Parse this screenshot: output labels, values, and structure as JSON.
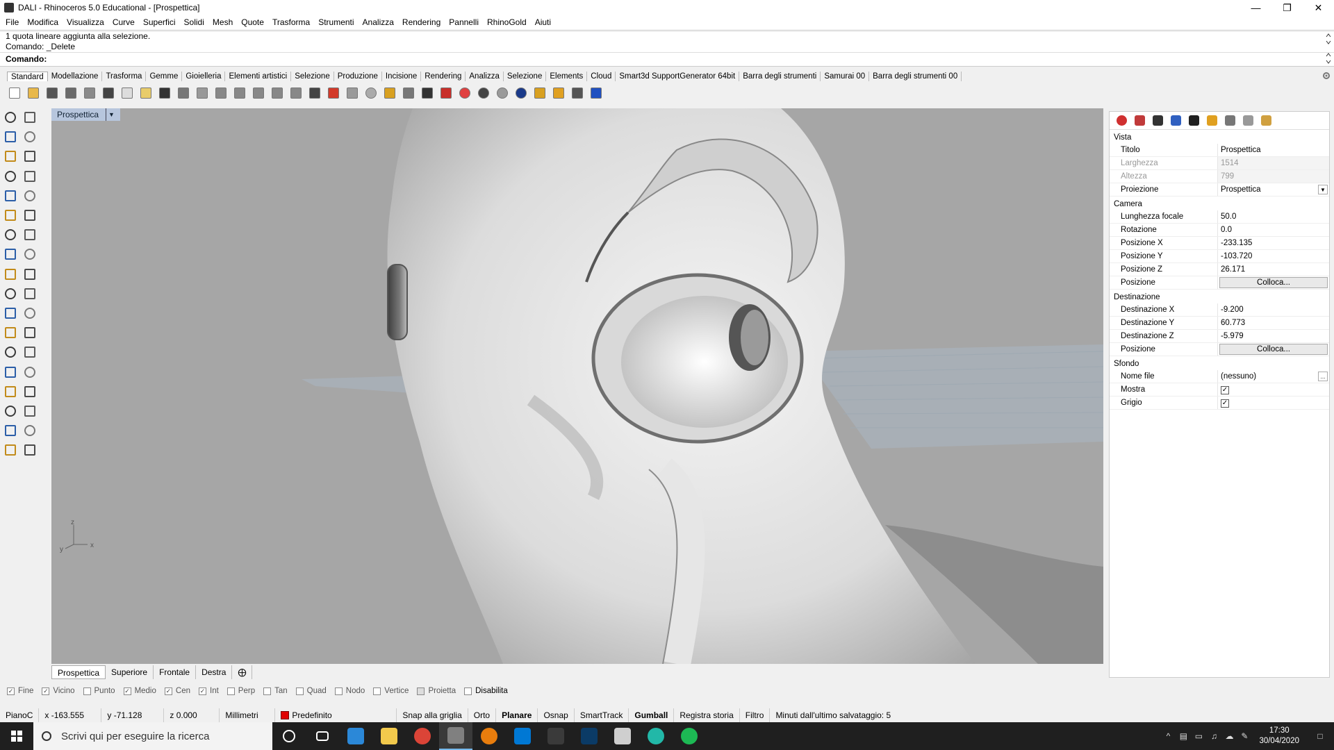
{
  "window": {
    "title": "DALI - Rhinoceros 5.0 Educational - [Prospettica]"
  },
  "menu": [
    "File",
    "Modifica",
    "Visualizza",
    "Curve",
    "Superfici",
    "Solidi",
    "Mesh",
    "Quote",
    "Trasforma",
    "Strumenti",
    "Analizza",
    "Rendering",
    "Pannelli",
    "RhinoGold",
    "Aiuti"
  ],
  "command": {
    "history": [
      "1 quota lineare aggiunta alla selezione.",
      "Comando: _Delete"
    ],
    "prompt": "Comando:"
  },
  "toolbar_tabs": [
    "Standard",
    "Modellazione",
    "Trasforma",
    "Gemme",
    "Gioielleria",
    "Elementi artistici",
    "Selezione",
    "Produzione",
    "Incisione",
    "Rendering",
    "Analizza",
    "Selezione",
    "Elements",
    "Cloud",
    "Smart3d SupportGenerator 64bit",
    "Barra degli strumenti",
    "Samurai 00",
    "Barra degli strumenti 00"
  ],
  "toolbar_icons": [
    {
      "name": "new-file-icon",
      "color": "#ffffff"
    },
    {
      "name": "open-folder-icon",
      "color": "#e8b84a"
    },
    {
      "name": "save-icon",
      "color": "#555555"
    },
    {
      "name": "print-icon",
      "color": "#6a6a6a"
    },
    {
      "name": "import-icon",
      "color": "#8a8a8a"
    },
    {
      "name": "cut-icon",
      "color": "#444444"
    },
    {
      "name": "copy-icon",
      "color": "#dddddd"
    },
    {
      "name": "paste-icon",
      "color": "#e8cc6a"
    },
    {
      "name": "undo-icon",
      "color": "#333333"
    },
    {
      "name": "pan-hand-icon",
      "color": "#777777"
    },
    {
      "name": "rotate-view-icon",
      "color": "#999999"
    },
    {
      "name": "zoom-icon",
      "color": "#888888"
    },
    {
      "name": "zoom-window-icon",
      "color": "#888888"
    },
    {
      "name": "zoom-extents-icon",
      "color": "#888888"
    },
    {
      "name": "zoom-selected-icon",
      "color": "#888888"
    },
    {
      "name": "undo-view-icon",
      "color": "#888888"
    },
    {
      "name": "four-viewports-icon",
      "color": "#444444"
    },
    {
      "name": "car-icon",
      "color": "#d23a2a"
    },
    {
      "name": "plane-icon",
      "color": "#9a9a9a"
    },
    {
      "name": "target-icon",
      "color": "#aaaaaa"
    },
    {
      "name": "select-points-icon",
      "color": "#d8a020"
    },
    {
      "name": "light-bulb-icon",
      "color": "#777777"
    },
    {
      "name": "lock-icon",
      "color": "#333333"
    },
    {
      "name": "layer-icon",
      "color": "#c8302a"
    },
    {
      "name": "color-wheel-icon",
      "color": "#e04040"
    },
    {
      "name": "shaded-sphere-icon",
      "color": "#444444"
    },
    {
      "name": "rendered-sphere-icon",
      "color": "#9a9a9a"
    },
    {
      "name": "render-sphere-icon",
      "color": "#1a3a8a"
    },
    {
      "name": "filter-icon",
      "color": "#d8a020"
    },
    {
      "name": "gear-icon",
      "color": "#e0a020"
    },
    {
      "name": "dimension-icon",
      "color": "#555555"
    },
    {
      "name": "help-icon",
      "color": "#2050c0"
    }
  ],
  "left_tools": [
    "select-arrow-icon",
    "point-icon",
    "polyline-icon",
    "control-point-curve-icon",
    "circle-icon",
    "ellipse-icon",
    "arc-icon",
    "rectangle-icon",
    "polygon-icon",
    "curve-tools-icon",
    "surface-icon",
    "surface-tools-icon",
    "box-icon",
    "solid-tools-icon",
    "extrude-icon",
    "mesh-icon",
    "boolean-icon",
    "gold-icon",
    "move-icon",
    "transform-icon",
    "group-icon",
    "block-icon",
    "fillet-icon",
    "offset-icon",
    "text-icon",
    "dimension-icon",
    "array-icon",
    "align-icon",
    "render-icon",
    "analyze-icon",
    "grid-array-icon",
    "snap-icon",
    "sphere-tools-icon",
    "wrap-icon",
    "check-icon",
    "gem-icon"
  ],
  "viewport": {
    "label": "Prospettica",
    "axes": {
      "x": "x",
      "y": "y",
      "z": "z"
    }
  },
  "view_tabs": [
    "Prospettica",
    "Superiore",
    "Frontale",
    "Destra"
  ],
  "osnaps": [
    {
      "label": "Fine",
      "checked": true
    },
    {
      "label": "Vicino",
      "checked": true
    },
    {
      "label": "Punto",
      "checked": false
    },
    {
      "label": "Medio",
      "checked": true
    },
    {
      "label": "Cen",
      "checked": true
    },
    {
      "label": "Int",
      "checked": true
    },
    {
      "label": "Perp",
      "checked": false
    },
    {
      "label": "Tan",
      "checked": false
    },
    {
      "label": "Quad",
      "checked": false
    },
    {
      "label": "Nodo",
      "checked": false
    },
    {
      "label": "Vertice",
      "checked": false
    },
    {
      "label": "Proietta",
      "checked": false
    },
    {
      "label": "Disabilita",
      "checked": false
    }
  ],
  "status": {
    "cplane": "PianoC",
    "x": "x -163.555",
    "y": "y -71.128",
    "z": "z 0.000",
    "units": "Millimetri",
    "layer": "Predefinito",
    "layer_color": "#e00000",
    "toggles": [
      "Snap alla griglia",
      "Orto",
      "Planare",
      "Osnap",
      "SmartTrack",
      "Gumball",
      "Registra storia",
      "Filtro"
    ],
    "save_info": "Minuti dall'ultimo salvataggio: 5"
  },
  "properties": {
    "sections": {
      "vista": "Vista",
      "camera": "Camera",
      "destinazione": "Destinazione",
      "sfondo": "Sfondo"
    },
    "vista": [
      {
        "k": "Titolo",
        "v": "Prospettica"
      },
      {
        "k": "Larghezza",
        "v": "1514"
      },
      {
        "k": "Altezza",
        "v": "799"
      },
      {
        "k": "Proiezione",
        "v": "Prospettica"
      }
    ],
    "camera": [
      {
        "k": "Lunghezza focale",
        "v": "50.0"
      },
      {
        "k": "Rotazione",
        "v": "0.0"
      },
      {
        "k": "Posizione X",
        "v": "-233.135"
      },
      {
        "k": "Posizione Y",
        "v": "-103.720"
      },
      {
        "k": "Posizione Z",
        "v": "26.171"
      },
      {
        "k": "Posizione",
        "v": "Colloca..."
      }
    ],
    "destinazione": [
      {
        "k": "Destinazione X",
        "v": "-9.200"
      },
      {
        "k": "Destinazione Y",
        "v": "60.773"
      },
      {
        "k": "Destinazione Z",
        "v": "-5.979"
      },
      {
        "k": "Posizione",
        "v": "Colloca..."
      }
    ],
    "sfondo": [
      {
        "k": "Nome file",
        "v": "(nessuno)"
      },
      {
        "k": "Mostra",
        "v": "✓"
      },
      {
        "k": "Grigio",
        "v": "✓"
      }
    ],
    "panel_icons": [
      "color-wheel-icon",
      "layer-icon",
      "display-icon",
      "help-icon",
      "rhinogold-icon",
      "light-icon",
      "history-icon",
      "camera-icon",
      "material-icon"
    ]
  },
  "taskbar": {
    "search_placeholder": "Scrivi qui per eseguire la ricerca",
    "apps": [
      {
        "name": "cortana-icon",
        "color": "#1f1f1f"
      },
      {
        "name": "task-view-icon",
        "color": "#1f1f1f"
      },
      {
        "name": "store-icon",
        "color": "#2b88d8"
      },
      {
        "name": "file-explorer-icon",
        "color": "#f2c94c"
      },
      {
        "name": "chrome-icon",
        "color": "#db4437"
      },
      {
        "name": "rhino-icon",
        "color": "#808080"
      },
      {
        "name": "blender-icon",
        "color": "#e87d0d"
      },
      {
        "name": "mail-icon",
        "color": "#0078d4"
      },
      {
        "name": "calculator-icon",
        "color": "#3a3a3a"
      },
      {
        "name": "photoshop-icon",
        "color": "#0b3b66"
      },
      {
        "name": "zbrush-icon",
        "color": "#cfcfcf"
      },
      {
        "name": "webex-icon",
        "color": "#22b8a8"
      },
      {
        "name": "spotify-icon",
        "color": "#1db954"
      }
    ],
    "time": "17:30",
    "date": "30/04/2020"
  }
}
